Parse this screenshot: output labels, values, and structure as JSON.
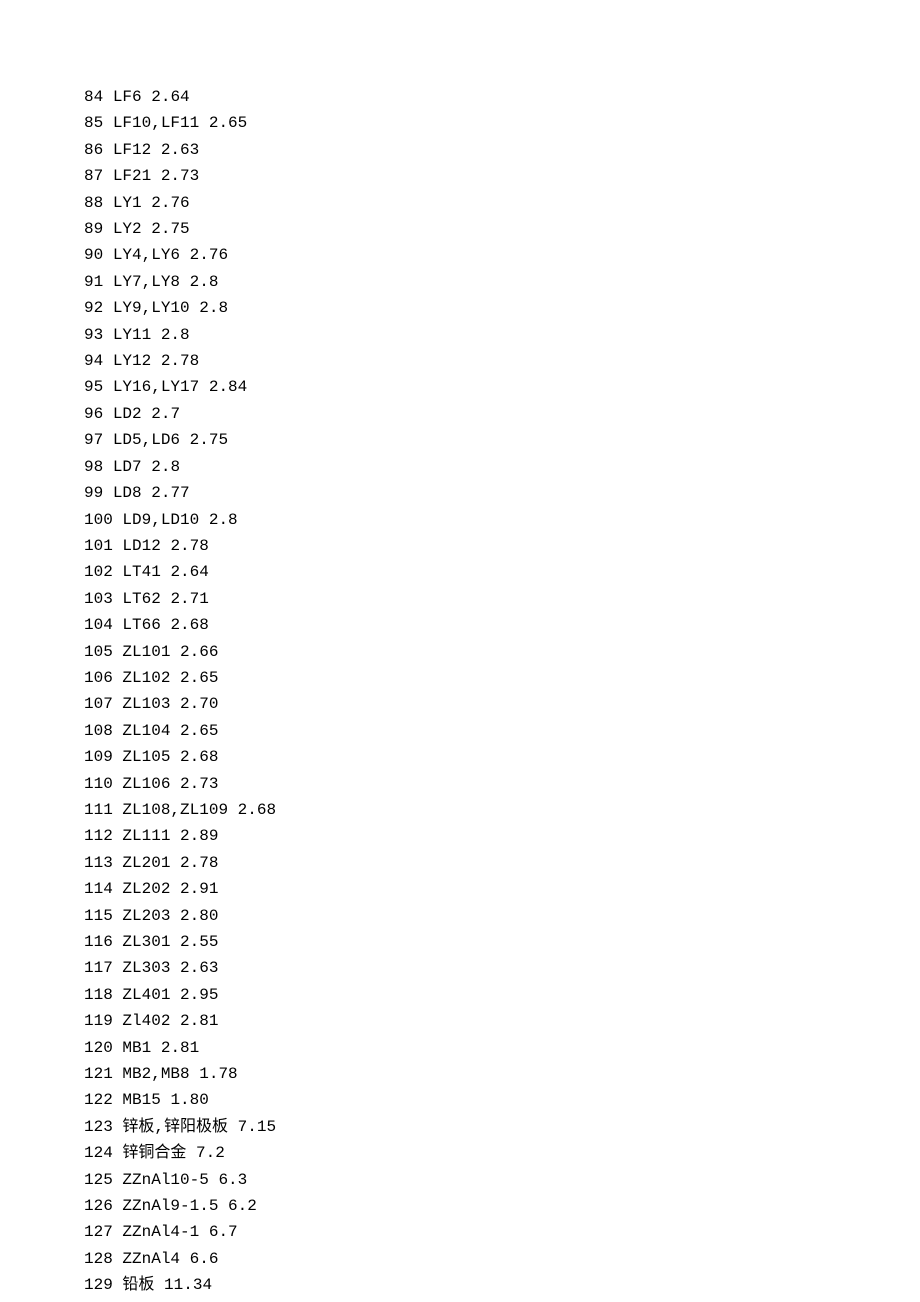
{
  "rows": [
    {
      "n": "84",
      "name": "LF6",
      "val": "2.64"
    },
    {
      "n": "85",
      "name": "LF10,LF11",
      "val": "2.65"
    },
    {
      "n": "86",
      "name": "LF12",
      "val": "2.63"
    },
    {
      "n": "87",
      "name": "LF21",
      "val": "2.73"
    },
    {
      "n": "88",
      "name": "LY1",
      "val": "2.76"
    },
    {
      "n": "89",
      "name": "LY2",
      "val": "2.75"
    },
    {
      "n": "90",
      "name": "LY4,LY6",
      "val": "2.76"
    },
    {
      "n": "91",
      "name": "LY7,LY8",
      "val": "2.8"
    },
    {
      "n": "92",
      "name": "LY9,LY10",
      "val": "2.8"
    },
    {
      "n": "93",
      "name": "LY11",
      "val": "2.8"
    },
    {
      "n": "94",
      "name": "LY12",
      "val": "2.78"
    },
    {
      "n": "95",
      "name": "LY16,LY17",
      "val": "2.84"
    },
    {
      "n": "96",
      "name": "LD2",
      "val": "2.7"
    },
    {
      "n": "97",
      "name": "LD5,LD6",
      "val": "2.75"
    },
    {
      "n": "98",
      "name": "LD7",
      "val": "2.8"
    },
    {
      "n": "99",
      "name": "LD8",
      "val": "2.77"
    },
    {
      "n": "100",
      "name": "LD9,LD10",
      "val": "2.8"
    },
    {
      "n": "101",
      "name": "LD12",
      "val": "2.78"
    },
    {
      "n": "102",
      "name": "LT41",
      "val": "2.64"
    },
    {
      "n": "103",
      "name": "LT62",
      "val": "2.71"
    },
    {
      "n": "104",
      "name": "LT66",
      "val": "2.68"
    },
    {
      "n": "105",
      "name": "ZL101",
      "val": "2.66"
    },
    {
      "n": "106",
      "name": "ZL102",
      "val": "2.65"
    },
    {
      "n": "107",
      "name": "ZL103",
      "val": "2.70"
    },
    {
      "n": "108",
      "name": "ZL104",
      "val": "2.65"
    },
    {
      "n": "109",
      "name": "ZL105",
      "val": "2.68"
    },
    {
      "n": "110",
      "name": "ZL106",
      "val": "2.73"
    },
    {
      "n": "111",
      "name": "ZL108,ZL109",
      "val": "2.68"
    },
    {
      "n": "112",
      "name": "ZL111",
      "val": "2.89"
    },
    {
      "n": "113",
      "name": "ZL201",
      "val": "2.78"
    },
    {
      "n": "114",
      "name": "ZL202",
      "val": "2.91"
    },
    {
      "n": "115",
      "name": "ZL203",
      "val": "2.80"
    },
    {
      "n": "116",
      "name": "ZL301",
      "val": "2.55"
    },
    {
      "n": "117",
      "name": "ZL303",
      "val": "2.63"
    },
    {
      "n": "118",
      "name": "ZL401",
      "val": "2.95"
    },
    {
      "n": "119",
      "name": "Zl402",
      "val": "2.81"
    },
    {
      "n": "120",
      "name": "MB1",
      "val": "2.81"
    },
    {
      "n": "121",
      "name": "MB2,MB8",
      "val": "1.78"
    },
    {
      "n": "122",
      "name": "MB15",
      "val": "1.80"
    },
    {
      "n": "123",
      "name": "锌板,锌阳极板",
      "val": "7.15"
    },
    {
      "n": "124",
      "name": "锌铜合金",
      "val": "7.2"
    },
    {
      "n": "125",
      "name": "ZZnAl10-5",
      "val": "6.3"
    },
    {
      "n": "126",
      "name": "ZZnAl9-1.5",
      "val": "6.2"
    },
    {
      "n": "127",
      "name": "ZZnAl4-1",
      "val": "6.7"
    },
    {
      "n": "128",
      "name": "ZZnAl4",
      "val": "6.6"
    },
    {
      "n": "129",
      "name": "铅板",
      "val": "11.34"
    }
  ]
}
